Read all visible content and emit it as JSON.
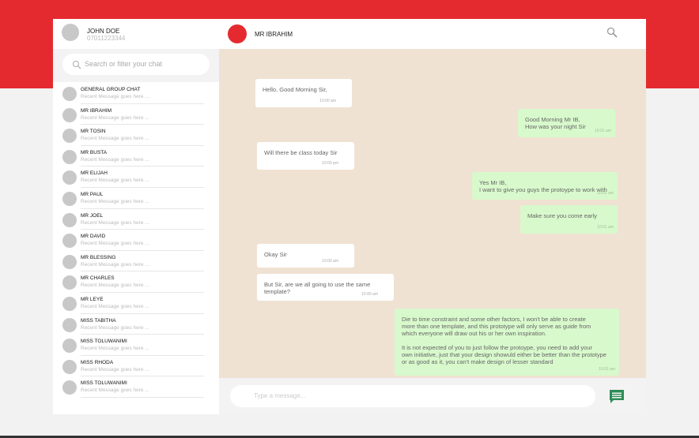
{
  "user": {
    "name": "JOHN DOE",
    "phone": "07011223344"
  },
  "search": {
    "placeholder": "Search or filter your chat"
  },
  "chats": [
    {
      "name": "GENERAL GROUP CHAT",
      "preview": "Recent Message goes here ..."
    },
    {
      "name": "MR IBRAHIM",
      "preview": "Recent Message goes here ..."
    },
    {
      "name": "MR TOSIN",
      "preview": "Recent Message goes here ..."
    },
    {
      "name": "MR BUSTA",
      "preview": "Recent Message goes here ..."
    },
    {
      "name": "MR ELIJAH",
      "preview": "Recent Message goes here ..."
    },
    {
      "name": "MR PAUL",
      "preview": "Recent Message goes here ..."
    },
    {
      "name": "MR JOEL",
      "preview": "Recent Message goes here ..."
    },
    {
      "name": "MR DAVID",
      "preview": "Recent Message goes here ..."
    },
    {
      "name": "MR BLESSING",
      "preview": "Recent Message goes here ..."
    },
    {
      "name": "MR CHARLES",
      "preview": "Recent Message goes here ..."
    },
    {
      "name": "MR LEYE",
      "preview": "Recent Message goes here ..."
    },
    {
      "name": "MISS TABITHA",
      "preview": "Recent Message goes here ..."
    },
    {
      "name": "MISS TOLUWANIMI",
      "preview": "Recent Message goes here ..."
    },
    {
      "name": "MISS RHODA",
      "preview": "Recent Message goes here ..."
    },
    {
      "name": "MISS TOLUWANIMI",
      "preview": "Recent Message goes here ..."
    }
  ],
  "conversation": {
    "contact_name": "MR IBRAHIM",
    "messages": [
      {
        "direction": "in",
        "text": "Hello, Good Morning Sir,",
        "time": "10:00 am"
      },
      {
        "direction": "out",
        "text": "Good Morning Mr IB,\nHow was your night Sir",
        "time": "10:01 am"
      },
      {
        "direction": "in",
        "text": "Will there be class today Sir",
        "time": "10:00 pm"
      },
      {
        "direction": "out",
        "text": "Yes Mr IB,\nI want to give you guys the protoype to work with",
        "time": "10:01 am"
      },
      {
        "direction": "out",
        "text": "Make sure you come early",
        "time": "10:01 am"
      },
      {
        "direction": "in",
        "text": "Okay Sir",
        "time": "10:00 am"
      },
      {
        "direction": "in",
        "text": "But Sir, are we all going to use the same\ntemplate?",
        "time": "10:00 am"
      },
      {
        "direction": "out",
        "text": "Die to time constraint and some other factors, I won't be able to create\nmore than one template, and this prototype will only serve as guide from\nwhich everyone will draw out his or her own inspiration.\n\nIt is not expected of you to just follow the protoype, you need to add your\nown initiative, just that your design showuld either be better than the prototype\nor as good as it, you can't make design of lesser standard",
        "time": "10:01 am"
      }
    ]
  },
  "composer": {
    "placeholder": "Type a message..."
  },
  "colors": {
    "accent": "#e52a2f",
    "incoming": "#ffffff",
    "outgoing": "#d8f9cc",
    "chat_background": "#f0e2d3",
    "send_icon": "#2e8b57"
  },
  "icons": {
    "search": "search-icon",
    "send": "message-send-icon"
  }
}
